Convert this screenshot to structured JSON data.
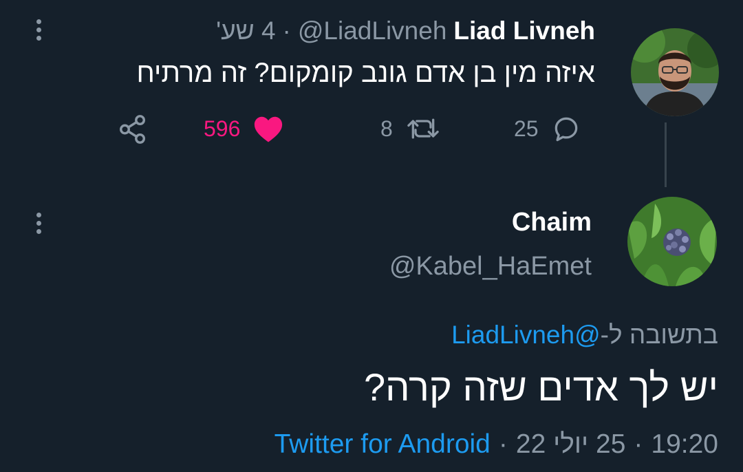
{
  "parent_tweet": {
    "author_name": "Liad Livneh",
    "author_handle": "@LiadLivneh",
    "separator": "·",
    "time_ago": "4 שע'",
    "text": "איזה מין בן אדם גונב קומקום? זה מרתיח",
    "actions": {
      "reply_count": "25",
      "retweet_count": "8",
      "like_count": "596",
      "liked": true
    },
    "avatar_icon": "person-photo"
  },
  "reply_tweet": {
    "author_name": "Chaim",
    "author_handle": "@Kabel_HaEmet",
    "replying_prefix": "בתשובה ל-",
    "replying_to": "@LiadLivneh",
    "text": "יש לך אדים שזה קרה?",
    "timestamp_time": "19:20",
    "timestamp_date": "25 יולי 22",
    "separator": "·",
    "client": "Twitter for Android",
    "avatar_icon": "plant-photo"
  },
  "colors": {
    "background": "#15202b",
    "text_primary": "#ffffff",
    "text_secondary": "#8b98a5",
    "link_blue": "#1d9bf0",
    "like_pink": "#f91880",
    "thread_line": "#38444d"
  }
}
